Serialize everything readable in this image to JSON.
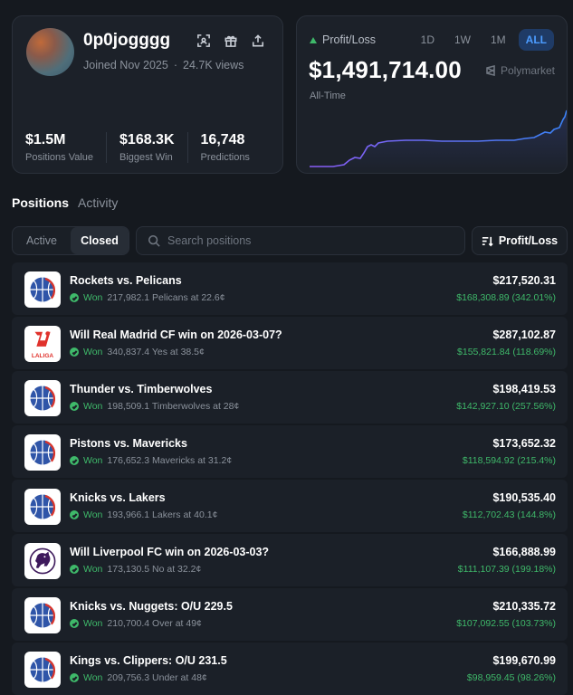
{
  "profile": {
    "username": "0p0jogggg",
    "joined": "Joined Nov 2025",
    "views": "24.7K views",
    "stats": [
      {
        "value": "$1.5M",
        "label": "Positions Value"
      },
      {
        "value": "$168.3K",
        "label": "Biggest Win"
      },
      {
        "value": "16,748",
        "label": "Predictions"
      }
    ]
  },
  "pnl": {
    "label": "Profit/Loss",
    "value": "$1,491,714.00",
    "brand": "Polymarket",
    "period": "All-Time",
    "ranges": [
      "1D",
      "1W",
      "1M",
      "ALL"
    ],
    "active_range": "ALL",
    "colors": {
      "up": "#3fb96a",
      "line_start": "#8b5cf6",
      "line_end": "#3b82f6"
    }
  },
  "tabs": {
    "positions": "Positions",
    "activity": "Activity"
  },
  "filters": {
    "active": "Active",
    "closed": "Closed",
    "search_placeholder": "Search positions",
    "sort_label": "Profit/Loss"
  },
  "positions": [
    {
      "icon": "basketball-icon",
      "title": "Rockets vs. Pelicans",
      "status": "Won",
      "detail": "217,982.1 Pelicans at 22.6¢",
      "value": "$217,520.31",
      "pnl": "$168,308.89 (342.01%)"
    },
    {
      "icon": "laliga-icon",
      "logo_text": "LALIGA",
      "title": "Will Real Madrid CF win on 2026-03-07?",
      "status": "Won",
      "detail": "340,837.4 Yes at 38.5¢",
      "value": "$287,102.87",
      "pnl": "$155,821.84 (118.69%)"
    },
    {
      "icon": "basketball-icon",
      "title": "Thunder vs. Timberwolves",
      "status": "Won",
      "detail": "198,509.1 Timberwolves at 28¢",
      "value": "$198,419.53",
      "pnl": "$142,927.10 (257.56%)"
    },
    {
      "icon": "basketball-icon",
      "title": "Pistons vs. Mavericks",
      "status": "Won",
      "detail": "176,652.3 Mavericks at 31.2¢",
      "value": "$173,652.32",
      "pnl": "$118,594.92 (215.4%)"
    },
    {
      "icon": "basketball-icon",
      "title": "Knicks vs. Lakers",
      "status": "Won",
      "detail": "193,966.1 Lakers at 40.1¢",
      "value": "$190,535.40",
      "pnl": "$112,702.43 (144.8%)"
    },
    {
      "icon": "premier-league-icon",
      "title": "Will Liverpool FC win on 2026-03-03?",
      "status": "Won",
      "detail": "173,130.5 No at 32.2¢",
      "value": "$166,888.99",
      "pnl": "$111,107.39 (199.18%)"
    },
    {
      "icon": "basketball-icon",
      "title": "Knicks vs. Nuggets: O/U 229.5",
      "status": "Won",
      "detail": "210,700.4 Over at 49¢",
      "value": "$210,335.72",
      "pnl": "$107,092.55 (103.73%)"
    },
    {
      "icon": "basketball-icon",
      "title": "Kings vs. Clippers: O/U 231.5",
      "status": "Won",
      "detail": "209,756.3 Under at 48¢",
      "value": "$199,670.99",
      "pnl": "$98,959.45 (98.26%)"
    }
  ]
}
